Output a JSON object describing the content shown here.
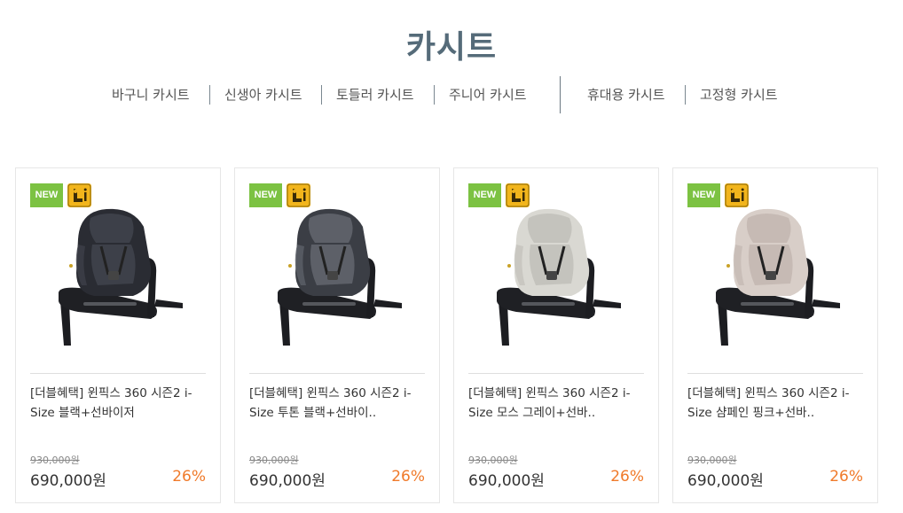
{
  "page": {
    "title": "카시트"
  },
  "categories": [
    {
      "label": "바구니 카시트"
    },
    {
      "label": "신생아 카시트"
    },
    {
      "label": "토들러 카시트"
    },
    {
      "label": "주니어 카시트"
    },
    {
      "label": "휴대용 카시트"
    },
    {
      "label": "고정형 카시트"
    }
  ],
  "colors": {
    "title": "#556b79",
    "new_badge": "#7cc242",
    "isize_badge": "#f2b51c",
    "discount": "#f07a2a"
  },
  "products": [
    {
      "badge_new": "NEW",
      "badge_icon": "i-size-icon",
      "name": "[더블혜택] 윈픽스 360 시즌2 i-Size 블랙+선바이저",
      "original_price": "930,000원",
      "price": "690,000원",
      "discount": "26%",
      "seat_color": "#2a2c33",
      "seat_accent": "#3d4049"
    },
    {
      "badge_new": "NEW",
      "badge_icon": "i-size-icon",
      "name": "[더블혜택] 윈픽스 360 시즌2 i-Size 투톤 블랙+선바이..",
      "original_price": "930,000원",
      "price": "690,000원",
      "discount": "26%",
      "seat_color": "#3b3e45",
      "seat_accent": "#5d6068"
    },
    {
      "badge_new": "NEW",
      "badge_icon": "i-size-icon",
      "name": "[더블혜택] 윈픽스 360 시즌2 i-Size 모스 그레이+선바..",
      "original_price": "930,000원",
      "price": "690,000원",
      "discount": "26%",
      "seat_color": "#d9d8d2",
      "seat_accent": "#c4c3bd"
    },
    {
      "badge_new": "NEW",
      "badge_icon": "i-size-icon",
      "name": "[더블혜택] 윈픽스 360 시즌2 i-Size 샴페인 핑크+선바..",
      "original_price": "930,000원",
      "price": "690,000원",
      "discount": "26%",
      "seat_color": "#d8cec8",
      "seat_accent": "#c6bab4"
    }
  ]
}
